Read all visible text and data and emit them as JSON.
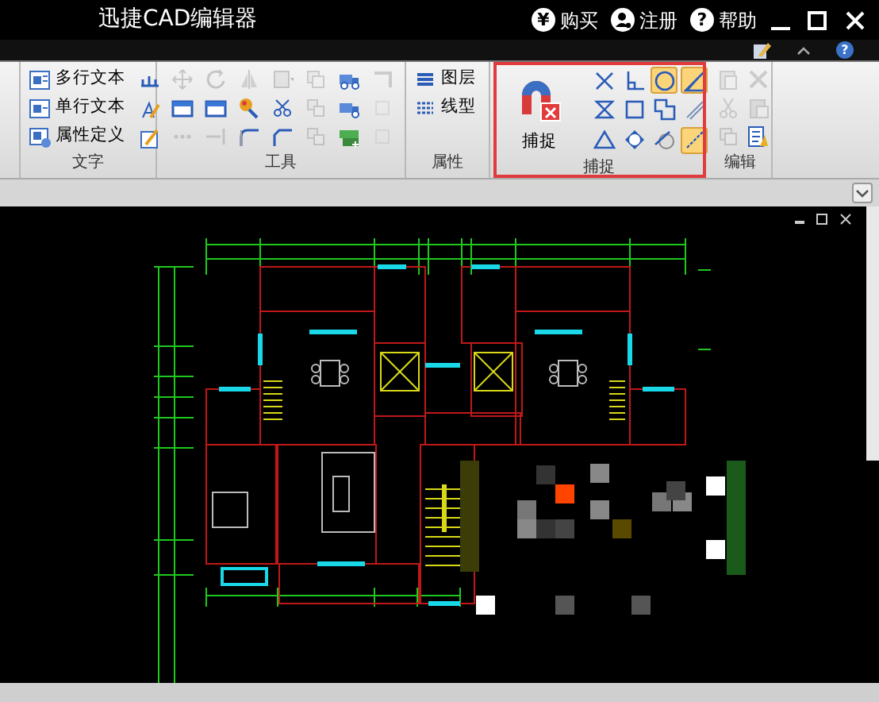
{
  "window": {
    "title": "迅捷CAD编辑器"
  },
  "title_actions": [
    {
      "kind": "glyph",
      "icon_char": "¥",
      "label": "购买"
    },
    {
      "kind": "person",
      "label": "注册"
    },
    {
      "kind": "glyph",
      "icon_char": "?",
      "label": "帮助"
    }
  ],
  "quick_help": {
    "icon_char": "?"
  },
  "ribbon": {
    "text_group": {
      "label": "文字",
      "items": [
        "多行文本",
        "单行文本",
        "属性定义"
      ]
    },
    "tools_group": {
      "label": "工具",
      "tools": [
        {
          "disabled": true
        },
        {
          "disabled": true
        },
        {
          "disabled": true
        },
        {
          "disabled": true
        },
        {
          "disabled": true
        },
        {
          "disabled": false
        },
        {
          "disabled": true
        },
        {
          "disabled": false
        },
        {
          "disabled": false
        },
        {
          "disabled": false
        },
        {
          "disabled": false
        },
        {
          "disabled": true
        },
        {
          "disabled": false
        },
        {
          "disabled": true
        },
        {
          "disabled": true
        },
        {
          "disabled": true
        },
        {
          "disabled": false
        },
        {
          "disabled": false
        },
        {
          "disabled": true
        },
        {
          "disabled": false
        },
        {
          "disabled": true
        }
      ]
    },
    "properties_group": {
      "label": "属性",
      "items": [
        "图层",
        "线型"
      ]
    },
    "snap_group": {
      "label": "捕捉",
      "button": "捕捉",
      "snaps": [
        {
          "selected": false
        },
        {
          "selected": false
        },
        {
          "selected": true
        },
        {
          "selected": true
        },
        {
          "selected": false
        },
        {
          "selected": false
        },
        {
          "selected": false
        },
        {
          "selected": false
        },
        {
          "selected": false
        },
        {
          "selected": false
        },
        {
          "selected": false
        },
        {
          "selected": true
        }
      ]
    },
    "edit_group": {
      "label": "编辑",
      "tools": [
        {
          "disabled": true
        },
        {
          "disabled": true
        },
        {
          "disabled": true
        },
        {
          "disabled": true
        },
        {
          "disabled": true
        },
        {
          "disabled": false
        }
      ]
    }
  }
}
